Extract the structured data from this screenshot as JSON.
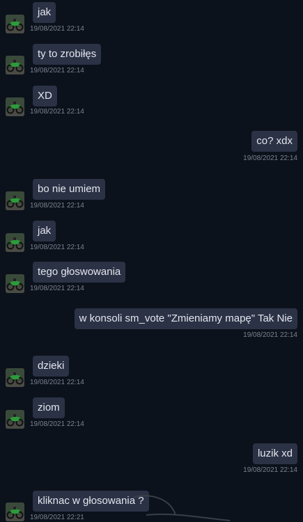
{
  "messages": [
    {
      "dir": "in",
      "text": "jak",
      "time": "19/08/2021 22:14"
    },
    {
      "dir": "in",
      "text": "ty to zrobiłęs",
      "time": "19/08/2021 22:14"
    },
    {
      "dir": "in",
      "text": "XD",
      "time": "19/08/2021 22:14"
    },
    {
      "dir": "out",
      "text": "co? xdx",
      "time": "19/08/2021 22:14"
    },
    {
      "dir": "in",
      "text": "bo nie umiem",
      "time": "19/08/2021 22:14"
    },
    {
      "dir": "in",
      "text": "jak",
      "time": "19/08/2021 22:14"
    },
    {
      "dir": "in",
      "text": "tego głoswowania",
      "time": "19/08/2021 22:14"
    },
    {
      "dir": "out",
      "text": "w konsoli sm_vote \"Zmieniamy mapę\" Tak Nie",
      "time": "19/08/2021 22:14"
    },
    {
      "dir": "in",
      "text": "dzieki",
      "time": "19/08/2021 22:14"
    },
    {
      "dir": "in",
      "text": "ziom",
      "time": "19/08/2021 22:14"
    },
    {
      "dir": "out",
      "text": "luzik xd",
      "time": "19/08/2021 22:14"
    },
    {
      "dir": "in",
      "text": "kliknac w głosowania ?",
      "time": "19/08/2021 22:21"
    }
  ],
  "colors": {
    "background": "#0b121b",
    "bubble": "#2b3245",
    "text": "#e3e6ee",
    "timestamp": "#7b8290"
  },
  "icons": {
    "avatar": "motorcycle-avatar-icon"
  }
}
